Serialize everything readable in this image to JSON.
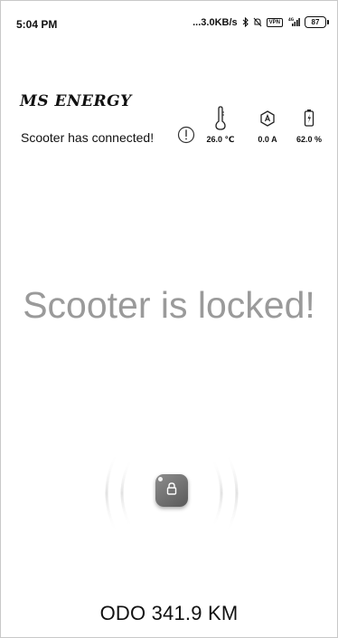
{
  "status_bar": {
    "time": "5:04 PM",
    "network_speed": "...3.0KB/s",
    "vpn_label": "VPN",
    "signal_label": "4G",
    "battery_level": "87"
  },
  "header": {
    "brand": "MS ENERGY",
    "connection_status": "Scooter has connected!"
  },
  "metrics": {
    "temperature": "26.0 ℃",
    "current": "0.0 A",
    "battery": "62.0 %"
  },
  "lock_message": "Scooter is locked!",
  "odometer": "ODO 341.9 KM",
  "icons": {
    "info": "info-icon",
    "thermometer": "thermometer-icon",
    "current": "current-icon",
    "battery": "battery-icon",
    "lock": "lock-icon"
  },
  "colors": {
    "lock_text": "#9a9a9a",
    "lock_button": "#6e6e6e"
  }
}
